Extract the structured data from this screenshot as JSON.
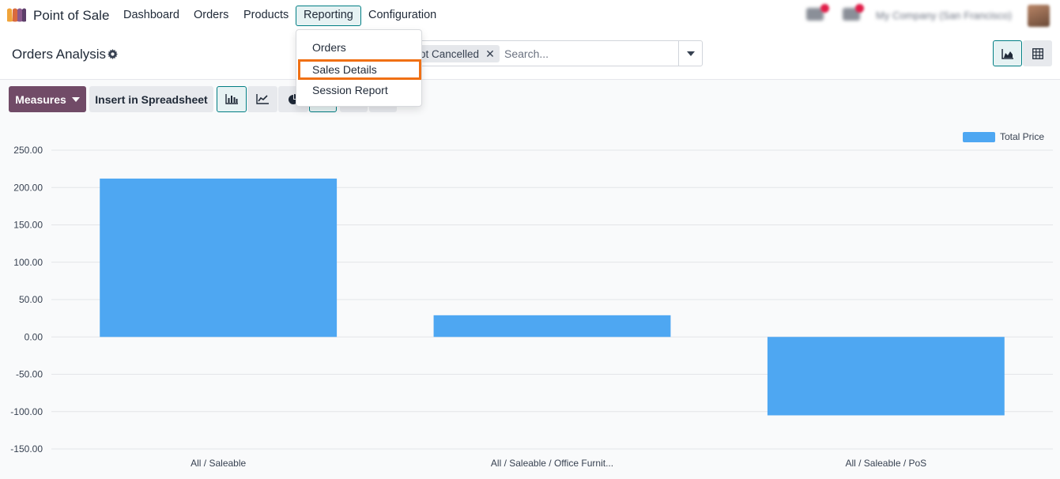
{
  "navbar": {
    "app_name": "Point of Sale",
    "menu": [
      {
        "label": "Dashboard"
      },
      {
        "label": "Orders"
      },
      {
        "label": "Products"
      },
      {
        "label": "Reporting"
      },
      {
        "label": "Configuration"
      }
    ],
    "company": "My Company (San Francisco)"
  },
  "control_panel": {
    "title": "Orders Analysis",
    "search": {
      "facet": "Not Cancelled",
      "facet_visible_text": "ot Cancelled",
      "placeholder": "Search..."
    }
  },
  "actions": {
    "measures_label": "Measures",
    "insert_label": "Insert in Spreadsheet"
  },
  "dropdown": {
    "items": [
      {
        "label": "Orders"
      },
      {
        "label": "Sales Details",
        "highlighted": true
      },
      {
        "label": "Session Report"
      }
    ]
  },
  "colors": {
    "accent": "#017e84",
    "brand": "#714b67",
    "bar": "#4ea7f2",
    "highlight": "#f07014"
  },
  "icons": {
    "app_logo": "pos-icon",
    "settings": "gear-icon",
    "view_graph": "area-chart-icon",
    "view_pivot": "table-icon",
    "chart_bar": "bar-chart-icon",
    "chart_line": "line-chart-icon",
    "chart_pie": "pie-chart-icon"
  },
  "chart_data": {
    "type": "bar",
    "categories": [
      "All / Saleable",
      "All / Saleable / Office Furnit...",
      "All / Saleable / PoS"
    ],
    "series": [
      {
        "name": "Total Price",
        "values": [
          212,
          29,
          -105
        ]
      }
    ],
    "ylim": [
      -150,
      250
    ],
    "yticks": [
      "250.00",
      "200.00",
      "150.00",
      "100.00",
      "50.00",
      "0.00",
      "-50.00",
      "-100.00",
      "-150.00"
    ],
    "grid": true,
    "legend": "top-right"
  }
}
